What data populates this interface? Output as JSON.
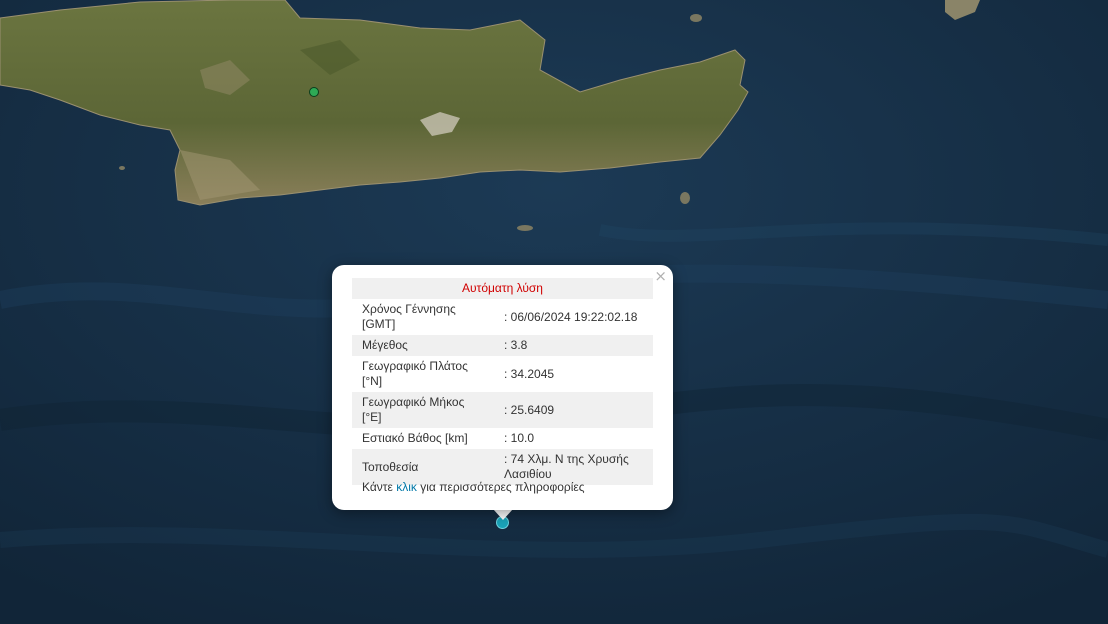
{
  "popup": {
    "title": "Αυτόματη λύση",
    "close_glyph": "×",
    "rows": [
      {
        "label": "Χρόνος Γέννησης [GMT]",
        "value": ": 06/06/2024 19:22:02.18"
      },
      {
        "label": "Μέγεθος",
        "value": ": 3.8"
      },
      {
        "label": "Γεωγραφικό Πλάτος [°N]",
        "value": ": 34.2045"
      },
      {
        "label": "Γεωγραφικό Μήκος [°E]",
        "value": ": 25.6409"
      },
      {
        "label": "Εστιακό Βάθος [km]",
        "value": ": 10.0"
      },
      {
        "label": "Τοποθεσία",
        "value": ": 74 Χλμ. Ν της Χρυσής Λασιθίου"
      }
    ],
    "footer_prefix": "Κάντε",
    "footer_link": "κλικ",
    "footer_suffix": "για περισσότερες πληροφορίες"
  },
  "markers": {
    "earthquake_color": "#1aa3b8",
    "station_color": "#2eaa55"
  },
  "colors": {
    "sea": "#16304a",
    "land": "#5f6a3a",
    "title_red": "#d00000",
    "link_blue": "#0078a8"
  }
}
